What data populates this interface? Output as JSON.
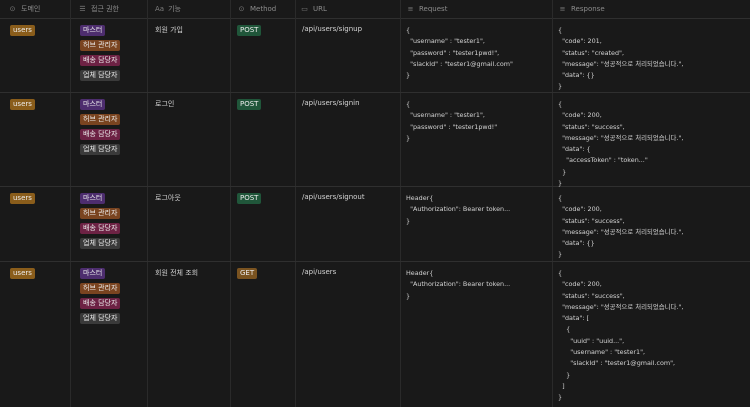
{
  "headers": {
    "domain": {
      "icon": "⊙",
      "label": "도메인"
    },
    "roles": {
      "icon": "☰",
      "label": "접근 권한"
    },
    "feature": {
      "icon": "Aa",
      "label": "기능"
    },
    "method": {
      "icon": "⊙",
      "label": "Method"
    },
    "url": {
      "icon": "▭",
      "label": "URL"
    },
    "request": {
      "icon": "≡",
      "label": "Request"
    },
    "response": {
      "icon": "≡",
      "label": "Response"
    }
  },
  "rows": [
    {
      "domain": "users",
      "roles": [
        "마스터",
        "허브 관리자",
        "배송 담당자",
        "업체 담당자"
      ],
      "feature": "회원 가입",
      "method": "POST",
      "url": "/api/users/signup",
      "request": "{\n  \"username\" : \"tester1\",\n  \"password\" : \"tester1pwd!\",\n  \"slackId\" : \"tester1@gmail.com\"\n}",
      "response": "{\n  \"code\": 201,\n  \"status\": \"created\",\n  \"message\": \"성공적으로 처리되었습니다.\",\n  \"data\": {}\n}"
    },
    {
      "domain": "users",
      "roles": [
        "마스터",
        "허브 관리자",
        "배송 담당자",
        "업체 담당자"
      ],
      "feature": "로그인",
      "method": "POST",
      "url": "/api/users/signin",
      "request": "{\n  \"username\" : \"tester1\",\n  \"password\" : \"tester1pwd!\"\n}",
      "response": "{\n  \"code\": 200,\n  \"status\": \"success\",\n  \"message\": \"성공적으로 처리되었습니다.\",\n  \"data\": {\n    \"accessToken\" : \"token...\"\n  }\n}"
    },
    {
      "domain": "users",
      "roles": [
        "마스터",
        "허브 관리자",
        "배송 담당자",
        "업체 담당자"
      ],
      "feature": "로그아웃",
      "method": "POST",
      "url": "/api/users/signout",
      "request": "Header{\n  \"Authorization\": Bearer token...\n}",
      "response": "{\n  \"code\": 200,\n  \"status\": \"success\",\n  \"message\": \"성공적으로 처리되었습니다.\",\n  \"data\": {}\n}"
    },
    {
      "domain": "users",
      "roles": [
        "마스터",
        "허브 관리자",
        "배송 담당자",
        "업체 담당자"
      ],
      "feature": "회원 전체 조회",
      "method": "GET",
      "url": "/api/users",
      "request": "Header{\n  \"Authorization\": Bearer token...\n}",
      "response": "{\n  \"code\": 200,\n  \"status\": \"success\",\n  \"message\": \"성공적으로 처리되었습니다.\",\n  \"data\": [\n    {\n      \"uuid\" : \"uuid...\",\n      \"username\" : \"tester1\",\n      \"slackId\" : \"tester1@gmail.com\",\n    }\n  ]\n}"
    }
  ],
  "colors": {
    "users_tag": "#8a5d1b",
    "role_master": "#4d2d6e",
    "role_hub": "#7a4420",
    "role_ship": "#6d2244",
    "role_vendor": "#3a3a3a",
    "method_post": "#20563a",
    "method_get": "#7a5320"
  }
}
